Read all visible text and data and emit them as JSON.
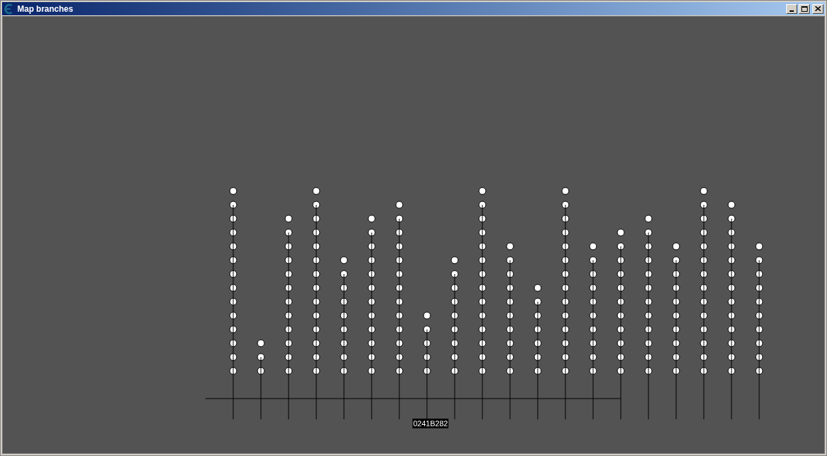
{
  "window": {
    "title": "Map branches"
  },
  "branch_label": "0241B282"
}
